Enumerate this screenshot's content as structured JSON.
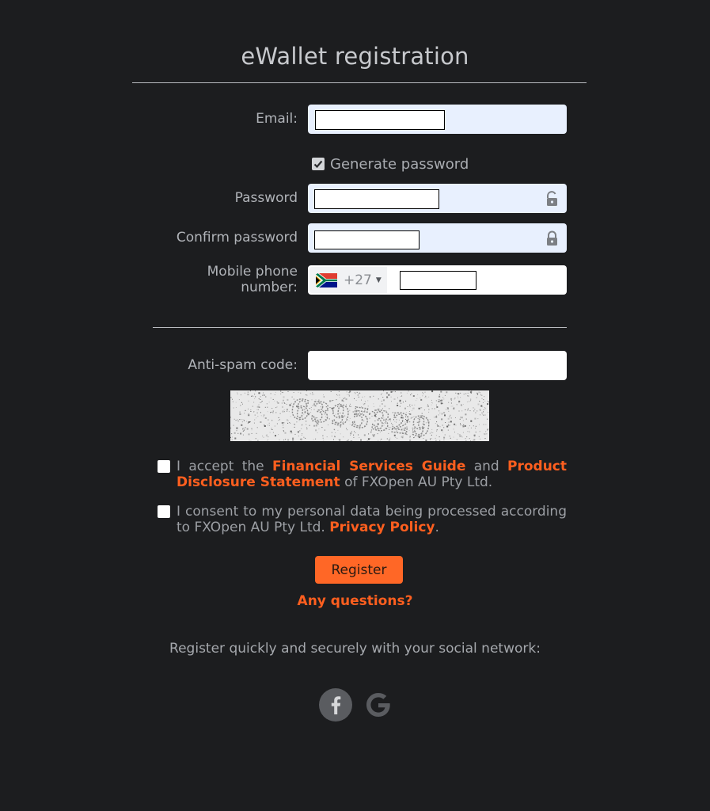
{
  "header": {
    "title": "eWallet registration"
  },
  "form": {
    "email": {
      "label": "Email:",
      "value": ""
    },
    "generate_password": {
      "label": "Generate password",
      "checked": true
    },
    "password": {
      "label": "Password",
      "value": ""
    },
    "confirm_password": {
      "label": "Confirm password",
      "value": ""
    },
    "phone": {
      "label_line1": "Mobile phone",
      "label_line2": "number:",
      "country_code": "+27",
      "country_flag": "south-africa-flag",
      "value": ""
    },
    "antispam": {
      "label": "Anti-spam code:",
      "value": "",
      "captcha_text": "6395329"
    }
  },
  "consents": {
    "terms": {
      "prefix": "I accept the ",
      "link1": "Financial Services Guide",
      "middle": " and ",
      "link2": "Product Disclosure Statement",
      "suffix": " of FXOpen AU Pty Ltd.",
      "checked": false
    },
    "privacy": {
      "prefix": "I consent to my personal data being processed according to FXOpen AU Pty Ltd. ",
      "link": "Privacy Policy",
      "suffix": ".",
      "checked": false
    }
  },
  "actions": {
    "register_label": "Register",
    "questions_label": "Any questions?"
  },
  "social": {
    "prompt": "Register quickly and securely with your social network:",
    "providers": [
      "facebook-icon",
      "google-icon"
    ]
  },
  "colors": {
    "background": "#1c1d1f",
    "accent": "#ff6726",
    "link": "#ff5f1f",
    "autofill": "#e8f0fe"
  }
}
